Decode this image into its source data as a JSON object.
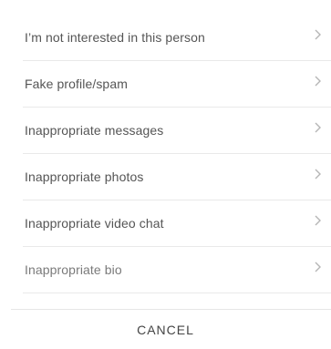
{
  "report_sheet": {
    "options": [
      {
        "label": "I’m not interested in this person",
        "icon": "chevron-right-icon"
      },
      {
        "label": "Fake profile/spam",
        "icon": "chevron-right-icon"
      },
      {
        "label": "Inappropriate messages",
        "icon": "chevron-right-icon"
      },
      {
        "label": "Inappropriate photos",
        "icon": "chevron-right-icon"
      },
      {
        "label": "Inappropriate video chat",
        "icon": "chevron-right-icon"
      },
      {
        "label": "Inappropriate bio",
        "icon": "chevron-right-icon"
      }
    ],
    "cancel_label": "CANCEL"
  },
  "colors": {
    "background": "#ffffff",
    "option_text": "#555555",
    "option_text_muted": "#7a7a7a",
    "divider": "#e9e9e9",
    "chevron": "#b5b5b5",
    "cancel_text": "#444444"
  }
}
